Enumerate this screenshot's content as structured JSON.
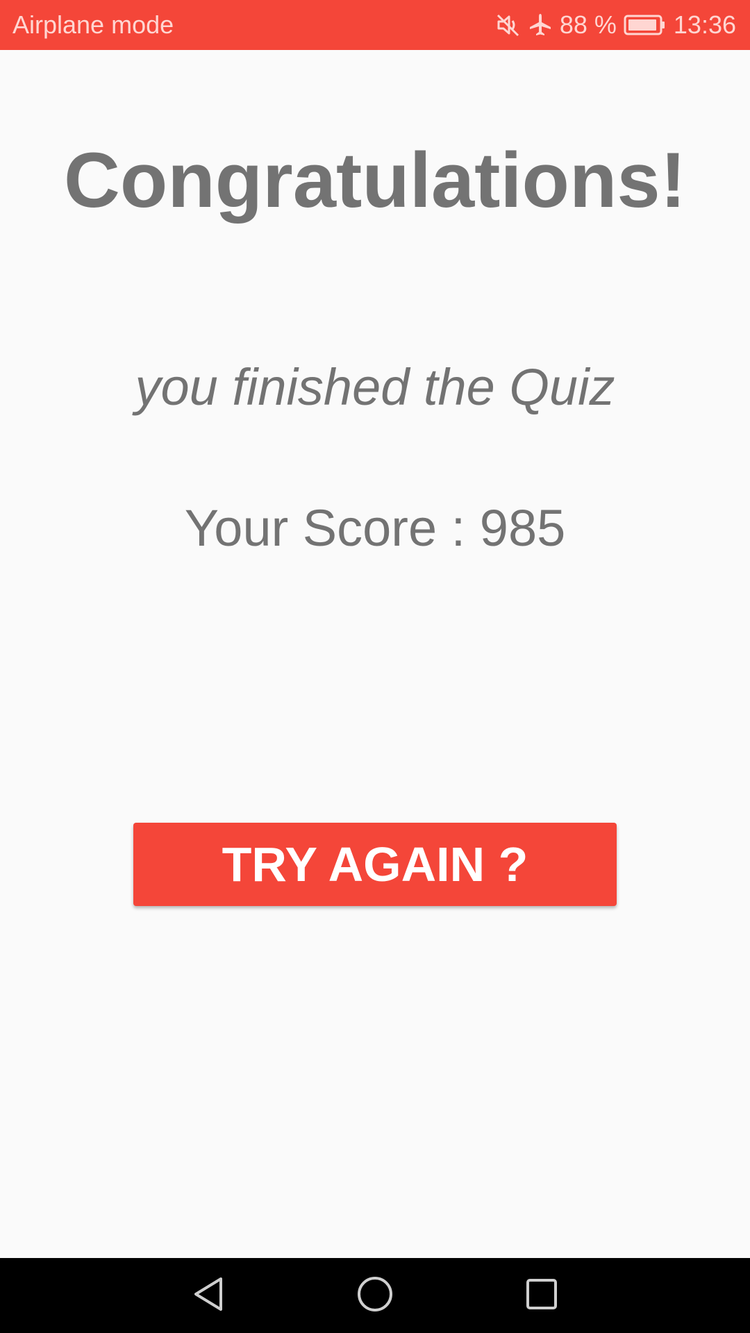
{
  "status_bar": {
    "left_text": "Airplane mode",
    "battery_text": "88 %",
    "time": "13:36",
    "icons": [
      "mute-icon",
      "airplane-icon",
      "battery-icon"
    ],
    "background_color": "#f44639"
  },
  "main": {
    "title": "Congratulations!",
    "subtitle": "you finished the Quiz",
    "score_text": "Your Score : 985",
    "score_value": 985,
    "text_color": "#737373"
  },
  "action": {
    "try_again_label": "TRY AGAIN ?",
    "button_color": "#f44639"
  },
  "nav_bar": {
    "buttons": [
      "back-icon",
      "home-icon",
      "recents-icon"
    ]
  }
}
